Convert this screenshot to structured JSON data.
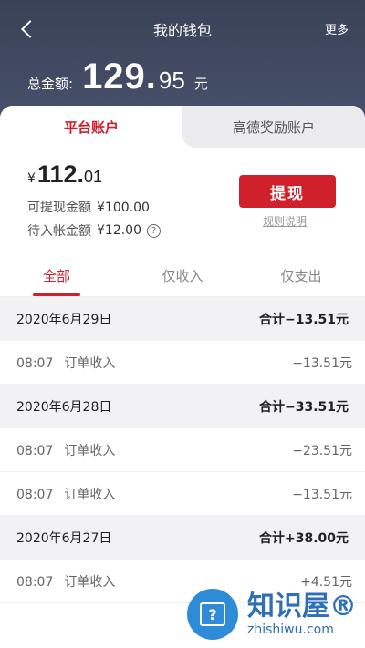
{
  "header": {
    "title": "我的钱包",
    "more": "更多"
  },
  "total": {
    "label": "总金额:",
    "integer": "129.",
    "decimal": "95",
    "unit": "元"
  },
  "accounts": {
    "active": "平台账户",
    "inactive": "高德奖励账户"
  },
  "balance": {
    "yen": "¥",
    "integer": "112.",
    "decimal": "01",
    "withdrawable_label": "可提现金额",
    "withdrawable_value": "¥100.00",
    "pending_label": "待入帐金额",
    "pending_value": "¥12.00",
    "withdraw_button": "提现",
    "rules_link": "规则说明"
  },
  "filter": {
    "tabs": [
      "全部",
      "仅收入",
      "仅支出"
    ],
    "active_index": 0
  },
  "groups": [
    {
      "date": "2020年6月29日",
      "sum": "合计−13.51元",
      "rows": [
        {
          "time": "08:07",
          "label": "订单收入",
          "amount": "−13.51元"
        }
      ]
    },
    {
      "date": "2020年6月28日",
      "sum": "合计−33.51元",
      "rows": [
        {
          "time": "08:07",
          "label": "订单收入",
          "amount": "−23.51元"
        },
        {
          "time": "08:07",
          "label": "订单收入",
          "amount": "−13.51元"
        }
      ]
    },
    {
      "date": "2020年6月27日",
      "sum": "合计+38.00元",
      "rows": [
        {
          "time": "08:07",
          "label": "订单收入",
          "amount": "+4.51元"
        }
      ]
    }
  ],
  "watermark": {
    "cn": "知识屋®",
    "en": "zhishiwu.com"
  },
  "colors": {
    "accent": "#d0202b",
    "header_bg": "#3f4760"
  }
}
